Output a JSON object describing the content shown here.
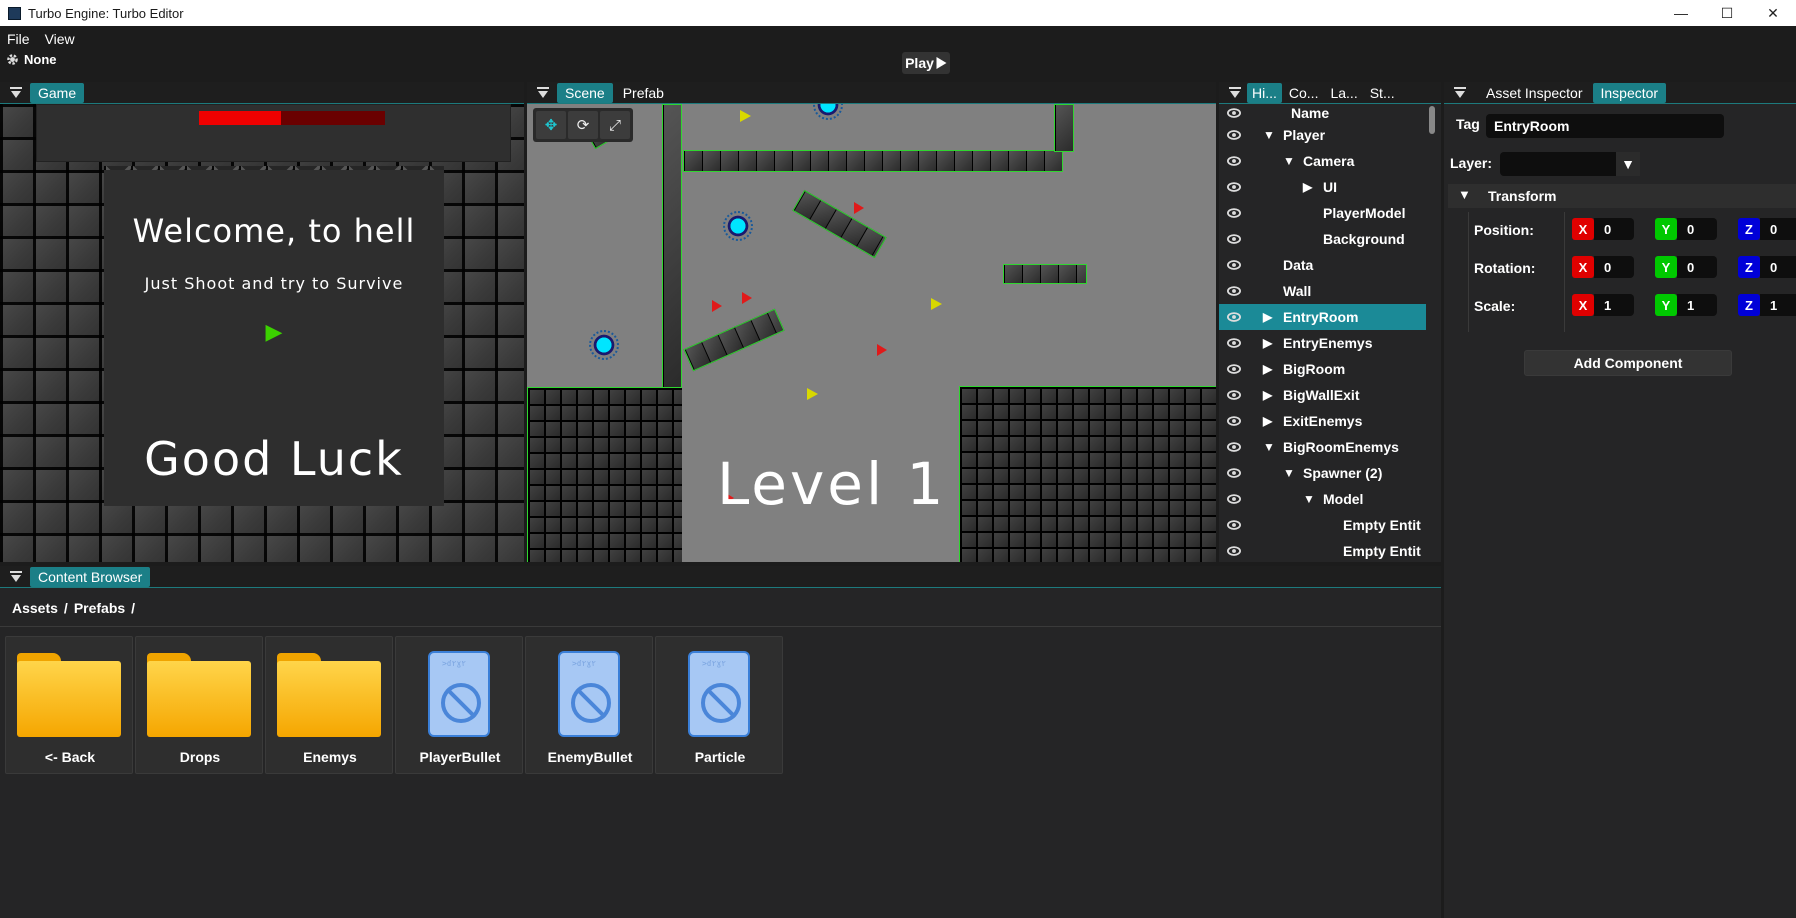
{
  "window": {
    "title": "Turbo Engine: Turbo Editor",
    "minimize": "—",
    "maximize": "☐",
    "close": "✕"
  },
  "menu": {
    "file": "File",
    "view": "View"
  },
  "toolbar": {
    "scene_name": "None",
    "play_label": "Play"
  },
  "game_panel": {
    "tab": "Game",
    "health_fraction": 0.44,
    "title_text": "Welcome, to hell",
    "subtitle_text": "Just Shoot and try to Survive",
    "play_glyph": "▶",
    "footer_text": "Good Luck"
  },
  "scene_panel": {
    "tabs": [
      "Scene",
      "Prefab"
    ],
    "level_text": "Level 1",
    "gizmos": [
      "move-gizmo-icon",
      "rotate-gizmo-icon",
      "scale-gizmo-icon"
    ]
  },
  "hierarchy_panel": {
    "tabs": [
      "Hi...",
      "Co...",
      "La...",
      "St..."
    ],
    "header": "Name",
    "items": [
      {
        "label": "Player",
        "arrow": "▼",
        "depth": 0
      },
      {
        "label": "Camera",
        "arrow": "▼",
        "depth": 1
      },
      {
        "label": "UI",
        "arrow": "▶",
        "depth": 2
      },
      {
        "label": "PlayerModel",
        "arrow": "",
        "depth": 2
      },
      {
        "label": "Background",
        "arrow": "",
        "depth": 2
      },
      {
        "label": "Data",
        "arrow": "",
        "depth": 0
      },
      {
        "label": "Wall",
        "arrow": "",
        "depth": 0
      },
      {
        "label": "EntryRoom",
        "arrow": "▶",
        "depth": 0,
        "selected": true
      },
      {
        "label": "EntryEnemys",
        "arrow": "▶",
        "depth": 0
      },
      {
        "label": "BigRoom",
        "arrow": "▶",
        "depth": 0
      },
      {
        "label": "BigWallExit",
        "arrow": "▶",
        "depth": 0
      },
      {
        "label": "ExitEnemys",
        "arrow": "▶",
        "depth": 0
      },
      {
        "label": "BigRoomEnemys",
        "arrow": "▼",
        "depth": 0
      },
      {
        "label": "Spawner (2)",
        "arrow": "▼",
        "depth": 1
      },
      {
        "label": "Model",
        "arrow": "▼",
        "depth": 2
      },
      {
        "label": "Empty Entit",
        "arrow": "",
        "depth": 3
      },
      {
        "label": "Empty Entit",
        "arrow": "",
        "depth": 3
      }
    ]
  },
  "inspector_panel": {
    "tabs": [
      "Asset Inspector",
      "Inspector"
    ],
    "tag_label": "Tag",
    "tag_value": "EntryRoom",
    "layer_label": "Layer:",
    "layer_value": "",
    "transform_label": "Transform",
    "rows": [
      {
        "label": "Position:",
        "x": "0",
        "y": "0",
        "z": "0"
      },
      {
        "label": "Rotation:",
        "x": "0",
        "y": "0",
        "z": "0"
      },
      {
        "label": "Scale:",
        "x": "1",
        "y": "1",
        "z": "1"
      }
    ],
    "add_component": "Add Component"
  },
  "content_browser": {
    "tab": "Content Browser",
    "breadcrumb": [
      "Assets",
      "/",
      "Prefabs",
      "/"
    ],
    "items": [
      {
        "label": "<- Back",
        "kind": "folder"
      },
      {
        "label": "Drops",
        "kind": "folder"
      },
      {
        "label": "Enemys",
        "kind": "folder"
      },
      {
        "label": "PlayerBullet",
        "kind": "prefab"
      },
      {
        "label": "EnemyBullet",
        "kind": "prefab"
      },
      {
        "label": "Particle",
        "kind": "prefab"
      }
    ],
    "prefab_icon_text": ">ɗ۲ɣ۲"
  },
  "colors": {
    "accent_tab": "#1b7f87",
    "selection": "#1b8a97",
    "axis_x": "#e00000",
    "axis_y": "#00c800",
    "axis_z": "#0000d8",
    "health": "#f00000"
  }
}
